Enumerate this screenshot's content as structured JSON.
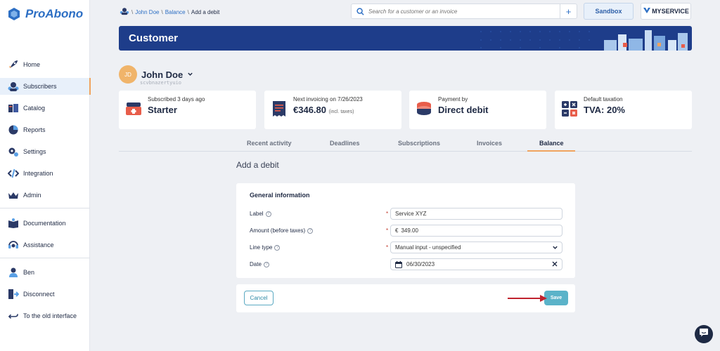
{
  "app": {
    "logo": "ProAbono"
  },
  "sidebar": {
    "items": [
      {
        "label": "Home",
        "icon": "rocket-icon"
      },
      {
        "label": "Subscribers",
        "icon": "subscribers-icon"
      },
      {
        "label": "Catalog",
        "icon": "catalog-icon"
      },
      {
        "label": "Reports",
        "icon": "pie-chart-icon"
      },
      {
        "label": "Settings",
        "icon": "gear-icon"
      },
      {
        "label": "Integration",
        "icon": "code-icon"
      },
      {
        "label": "Admin",
        "icon": "crown-icon"
      },
      {
        "label": "Documentation",
        "icon": "book-icon"
      },
      {
        "label": "Assistance",
        "icon": "headset-icon"
      },
      {
        "label": "Ben",
        "icon": "user-icon"
      },
      {
        "label": "Disconnect",
        "icon": "logout-icon"
      },
      {
        "label": "To the old interface",
        "icon": "back-arrow-icon"
      }
    ],
    "active": "Subscribers"
  },
  "breadcrumb": {
    "sep": "\\",
    "link1": "John Doe",
    "link2": "Balance",
    "current": "Add a debit"
  },
  "search": {
    "placeholder": "Search for a customer or an invoice",
    "plus": "+"
  },
  "header": {
    "sandbox": "Sandbox",
    "brand": "MYSERVICE"
  },
  "banner": {
    "title": "Customer"
  },
  "customer": {
    "initials": "JD",
    "name": "John Doe",
    "ref": "scvbnazertyuio"
  },
  "cards": [
    {
      "label": "Subscribed 3 days ago",
      "value": "Starter",
      "suffix": ""
    },
    {
      "label": "Next invoicing on 7/26/2023",
      "value": "€346.80",
      "suffix": "(incl. taxes)"
    },
    {
      "label": "Payment by",
      "value": "Direct debit",
      "suffix": ""
    },
    {
      "label": "Default taxation",
      "value": "TVA: 20%",
      "suffix": ""
    }
  ],
  "tabs": [
    "Recent activity",
    "Deadlines",
    "Subscriptions",
    "Invoices",
    "Balance"
  ],
  "active_tab": "Balance",
  "page": {
    "title": "Add a debit"
  },
  "form": {
    "section": "General information",
    "required_mark": "*",
    "help": "?",
    "label": {
      "label": "Label",
      "value": "Service XYZ"
    },
    "amount": {
      "label": "Amount (before taxes)",
      "currency": "€",
      "value": "349.00"
    },
    "line_type": {
      "label": "Line type",
      "value": "Manual input - unspecified"
    },
    "date": {
      "label": "Date",
      "value": "06/30/2023"
    }
  },
  "actions": {
    "cancel": "Cancel",
    "save": "Save"
  },
  "colors": {
    "primary": "#2d6fc4",
    "banner": "#1e3d8a",
    "accent": "#f0a35e",
    "save": "#5bb3c9"
  }
}
